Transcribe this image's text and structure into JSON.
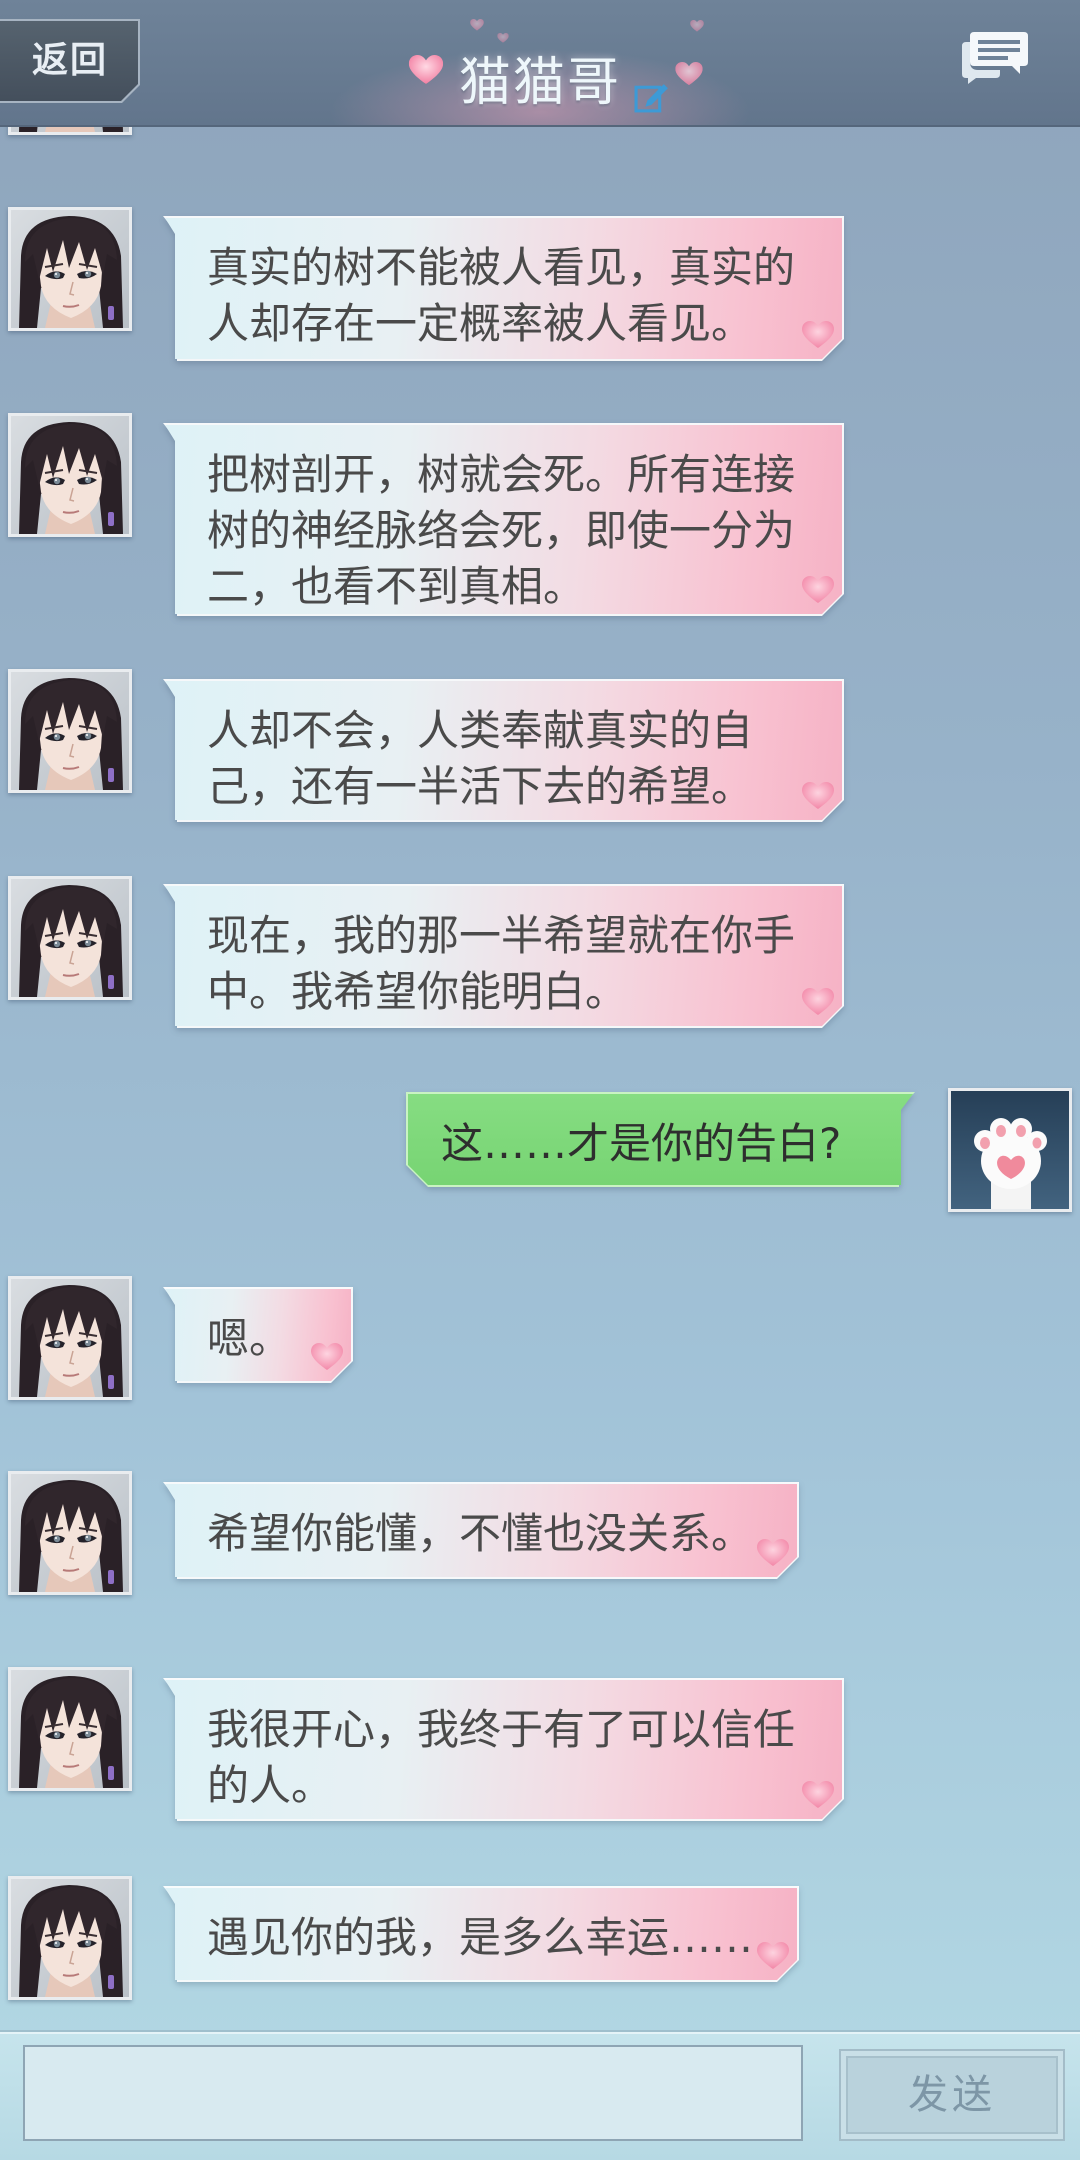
{
  "header": {
    "back_label": "返回",
    "title": "猫猫哥",
    "icons": [
      "edit-icon",
      "chat-icon",
      "heart-icon"
    ]
  },
  "avatars": {
    "contact": "male-portrait-avatar",
    "user": "cat-paw-avatar"
  },
  "colors": {
    "header": "#6a7e95",
    "chat_background_top": "#8ea4bb",
    "chat_background_bottom": "#b4dae5",
    "incoming_bubble_left": "#def2f7",
    "incoming_bubble_right": "#f6b2c5",
    "outgoing_bubble": "#80d97c",
    "heart": "#f3809f",
    "edit_icon": "#3d9ad6"
  },
  "messages": [
    {
      "lines": [
        "真实的树不能被人看见，真实的",
        "人却存在一定概率被人看见。"
      ]
    },
    {
      "lines": [
        "把树剖开，树就会死。所有连接",
        "树的神经脉络会死，即使一分为",
        "二，也看不到真相。"
      ]
    },
    {
      "lines": [
        "人却不会，人类奉献真实的自",
        "己，还有一半活下去的希望。"
      ]
    },
    {
      "lines": [
        "现在，我的那一半希望就在你手",
        "中。我希望你能明白。"
      ]
    },
    {
      "lines": [
        "这……才是你的告白?"
      ]
    },
    {
      "lines": [
        "嗯。"
      ]
    },
    {
      "lines": [
        "希望你能懂，不懂也没关系。"
      ]
    },
    {
      "lines": [
        "我很开心，我终于有了可以信任",
        "的人。"
      ]
    },
    {
      "lines": [
        "遇见你的我，是多么幸运……"
      ]
    }
  ],
  "composer": {
    "input_value": "",
    "send_label": "发送"
  }
}
